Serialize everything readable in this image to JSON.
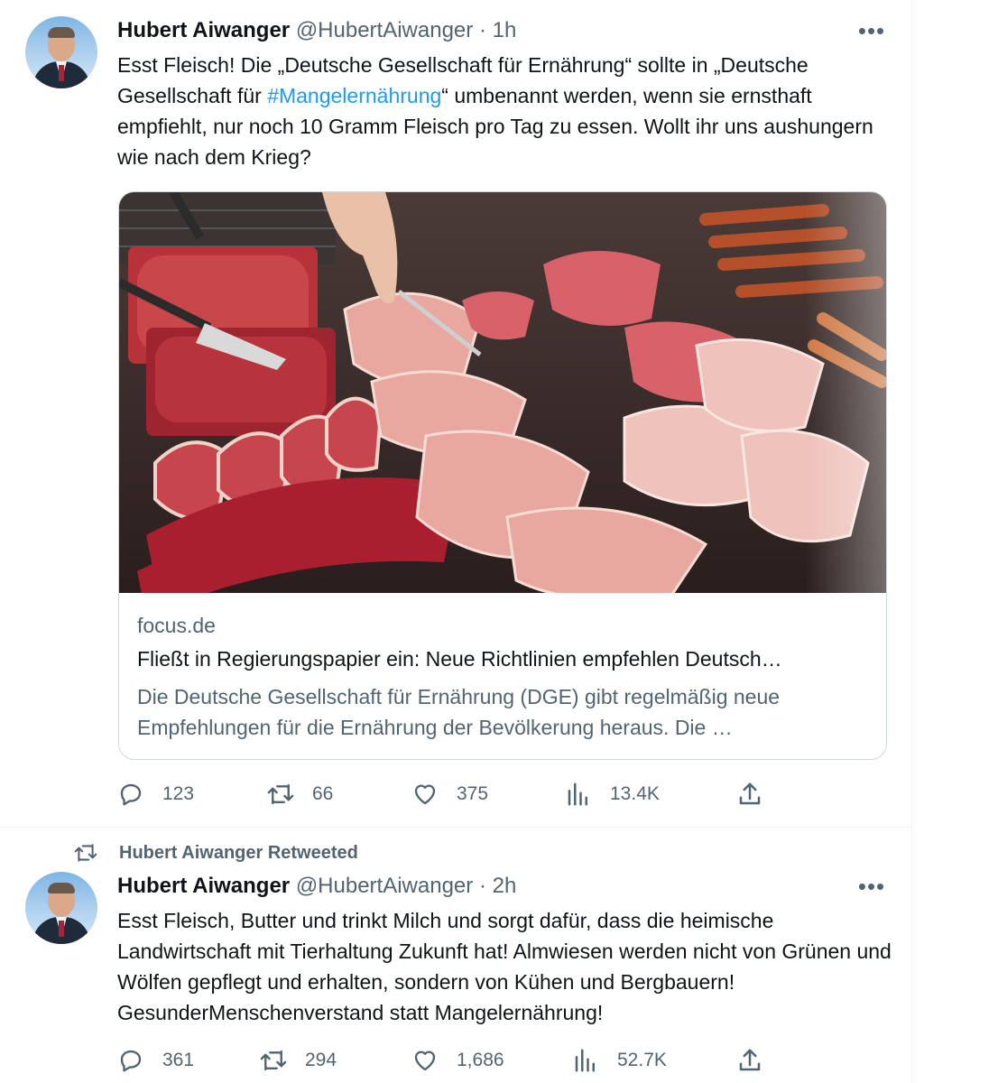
{
  "tweets": [
    {
      "author_name": "Hubert Aiwanger",
      "handle": "@HubertAiwanger",
      "separator": "·",
      "time": "1h",
      "more_label": "•••",
      "text_part1": "Esst Fleisch! Die „Deutsche Gesellschaft für Ernährung“ sollte in „Deutsche Gesellschaft für ",
      "hashtag": "#Mangelernährung",
      "text_part2": "“ umbenannt werden, wenn sie ernsthaft empfiehlt, nur noch 10 Gramm Fleisch pro Tag zu essen. Wollt ihr uns aushungern wie nach dem Krieg?",
      "card": {
        "domain": "focus.de",
        "title": "Fließt in Regierungspapier ein: Neue Richtlinien empfehlen Deutsch…",
        "description": "Die Deutsche Gesellschaft für Ernährung (DGE) gibt regelmäßig neue Empfehlungen für die Ernährung der Bevölkerung heraus. Die …"
      },
      "replies": "123",
      "retweets": "66",
      "likes": "375",
      "views": "13.4K"
    },
    {
      "retweeted_by": "Hubert Aiwanger Retweeted",
      "author_name": "Hubert Aiwanger",
      "handle": "@HubertAiwanger",
      "separator": "·",
      "time": "2h",
      "more_label": "•••",
      "text": "Esst Fleisch, Butter und trinkt Milch und sorgt dafür, dass die heimische Landwirtschaft mit Tierhaltung Zukunft hat! Almwiesen werden nicht von Grünen und Wölfen gepflegt und erhalten, sondern von Kühen und Bergbauern! GesunderMenschenverstand statt Mangelernährung!",
      "replies": "361",
      "retweets": "294",
      "likes": "1,686",
      "views": "52.7K"
    }
  ],
  "colors": {
    "text": "#0f1419",
    "secondary": "#536471",
    "link": "#1d9bf0",
    "border": "#cfd9de"
  },
  "icons": [
    "reply-icon",
    "retweet-icon",
    "like-icon",
    "views-icon",
    "share-icon",
    "more-icon"
  ]
}
